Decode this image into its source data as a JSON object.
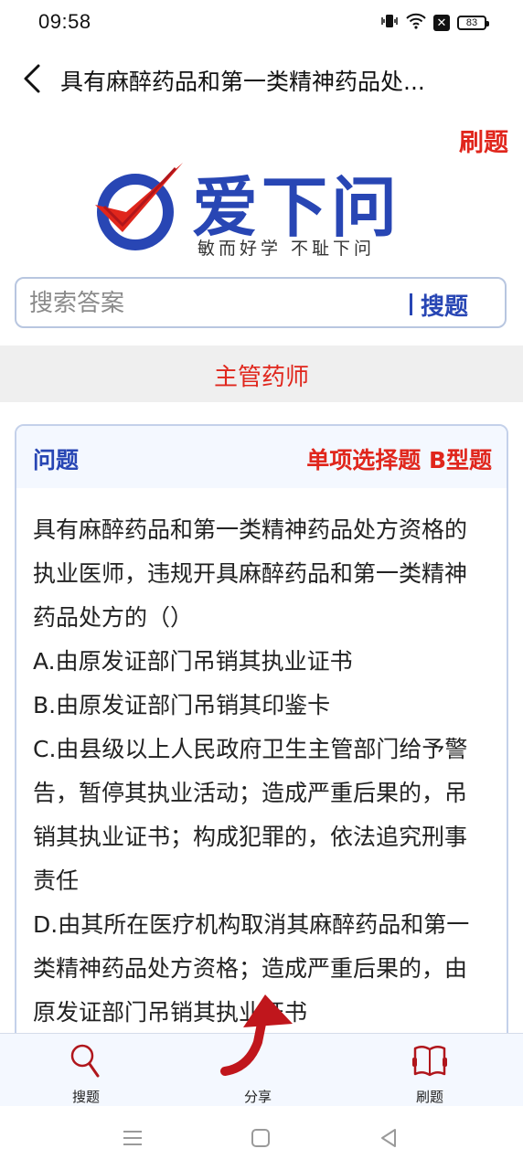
{
  "status_bar": {
    "time": "09:58",
    "battery": "83",
    "icons": [
      "vibrate-icon",
      "wifi-icon",
      "no-sim-icon",
      "battery-icon"
    ]
  },
  "nav": {
    "title": "具有麻醉药品和第一类精神药品处...",
    "back_icon": "chevron-left-icon"
  },
  "header": {
    "brush_link": "刷题",
    "logo": {
      "brand": "爱下问",
      "slogan": "敏而好学  不耻下问"
    }
  },
  "search": {
    "placeholder": "搜索答案",
    "value": "",
    "button": "搜题"
  },
  "category": "主管药师",
  "question": {
    "label": "问题",
    "type": "单项选择题 B型题",
    "stem": "具有麻醉药品和第一类精神药品处方资格的执业医师，违规开具麻醉药品和第一类精神药品处方的（）",
    "options": [
      "A.由原发证部门吊销其执业证书",
      "B.由原发证部门吊销其印鉴卡",
      "C.由县级以上人民政府卫生主管部门给予警告，暂停其执业活动；造成严重后果的，吊销其执业证书；构成犯罪的，依法追究刑事责任",
      "D.由其所在医疗机构取消其麻醉药品和第一类精神药品处方资格；造成严重后果的，由原发证部门吊销其执业证书"
    ]
  },
  "tabs": [
    {
      "label": "搜题",
      "icon": "search-icon"
    },
    {
      "label": "分享",
      "icon": "share-icon"
    },
    {
      "label": "刷题",
      "icon": "book-icon"
    }
  ],
  "colors": {
    "brand_blue": "#2846b4",
    "accent_red": "#e0261c",
    "card_border": "#c4d1ea",
    "band_gray": "#efefef"
  }
}
